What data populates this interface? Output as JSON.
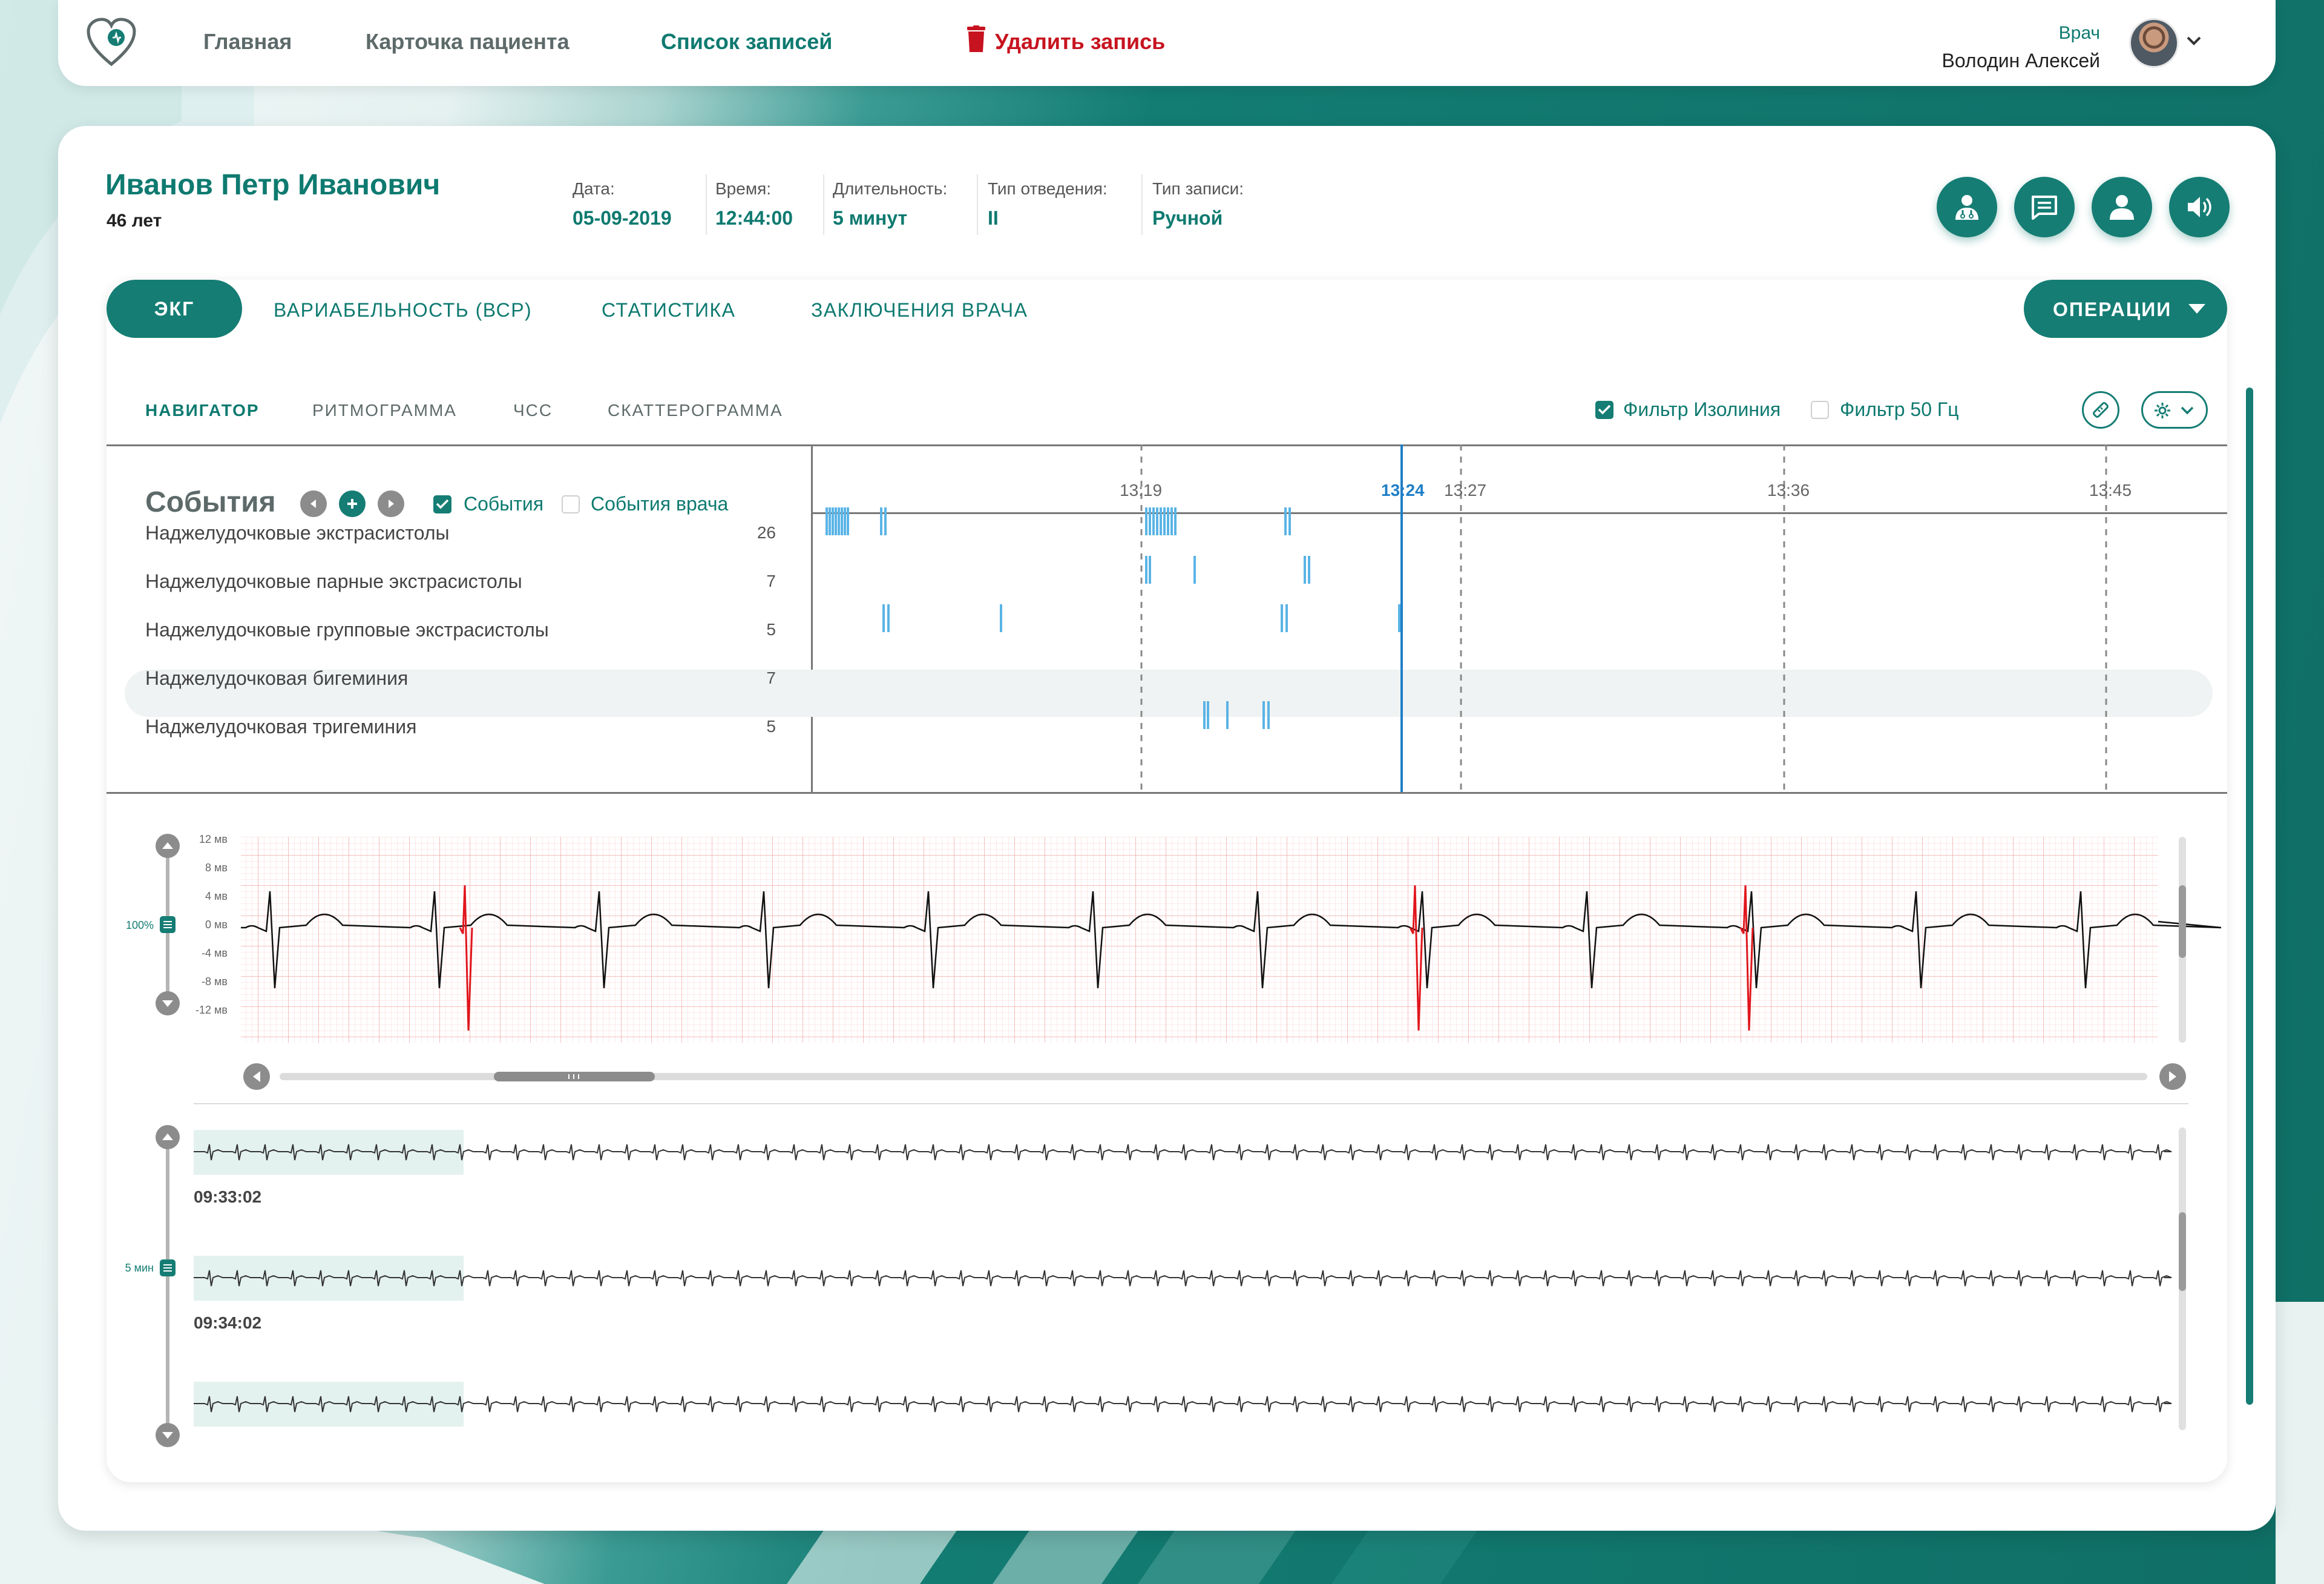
{
  "nav": {
    "home": "Главная",
    "patient_card": "Карточка пациента",
    "records_list": "Список записей",
    "delete_record": "Удалить запись",
    "user_role": "Врач",
    "user_name": "Володин Алексей"
  },
  "patient": {
    "name": "Иванов Петр Иванович",
    "age": "46 лет",
    "fields": [
      {
        "label": "Дата:",
        "value": "05-09-2019"
      },
      {
        "label": "Время:",
        "value": "12:44:00"
      },
      {
        "label": "Длительность:",
        "value": "5 минут"
      },
      {
        "label": "Тип отведения:",
        "value": "II"
      },
      {
        "label": "Тип записи:",
        "value": "Ручной"
      }
    ]
  },
  "actions": {
    "icons": [
      "doctor-icon",
      "message-icon",
      "user-icon",
      "sound-icon"
    ]
  },
  "tabs": {
    "active": "ЭКГ",
    "items": [
      "ВАРИАБЕЛЬНОСТЬ (ВСР)",
      "СТАТИСТИКА",
      "ЗАКЛЮЧЕНИЯ ВРАЧА"
    ],
    "operations": "ОПЕРАЦИИ"
  },
  "subtabs": {
    "active": "НАВИГАТОР",
    "items": [
      "РИТМОГРАММА",
      "ЧСС",
      "СКАТТЕРОГРАММА"
    ]
  },
  "filters": {
    "isoline": {
      "label": "Фильтр Изолиния",
      "checked": true
    },
    "hz50": {
      "label": "Фильтр 50 Гц",
      "checked": false
    }
  },
  "events": {
    "title": "События",
    "filter_events": {
      "label": "События",
      "checked": true
    },
    "filter_doctor": {
      "label": "События врача",
      "checked": false
    },
    "rows": [
      {
        "label": "Наджелудочковые экстрасистолы",
        "count": "26"
      },
      {
        "label": "Наджелудочковые парные экстрасистолы",
        "count": "7"
      },
      {
        "label": "Наджелудочковые групповые экстрасистолы",
        "count": "5"
      },
      {
        "label": "Наджелудочковая бигеминия",
        "count": "7"
      },
      {
        "label": "Наджелудочковая тригеминия",
        "count": "5"
      }
    ]
  },
  "timeline": {
    "ticks": [
      "13:19",
      "13:27",
      "13:36",
      "13:45"
    ],
    "cursor": "13:24"
  },
  "ecg": {
    "y_labels": [
      "12 мв",
      "8 мв",
      "4 мв",
      "0 мв",
      "-4 мв",
      "-8 мв",
      "-12 мв"
    ],
    "zoom": "100%",
    "colors": {
      "trace": "#111111",
      "highlight": "#e0161c",
      "grid": "#f6b3b3",
      "event": "#5ab4e6",
      "accent": "#157d74"
    }
  },
  "overview": {
    "zoom": "5 мин",
    "times": [
      "09:33:02",
      "09:34:02"
    ]
  }
}
